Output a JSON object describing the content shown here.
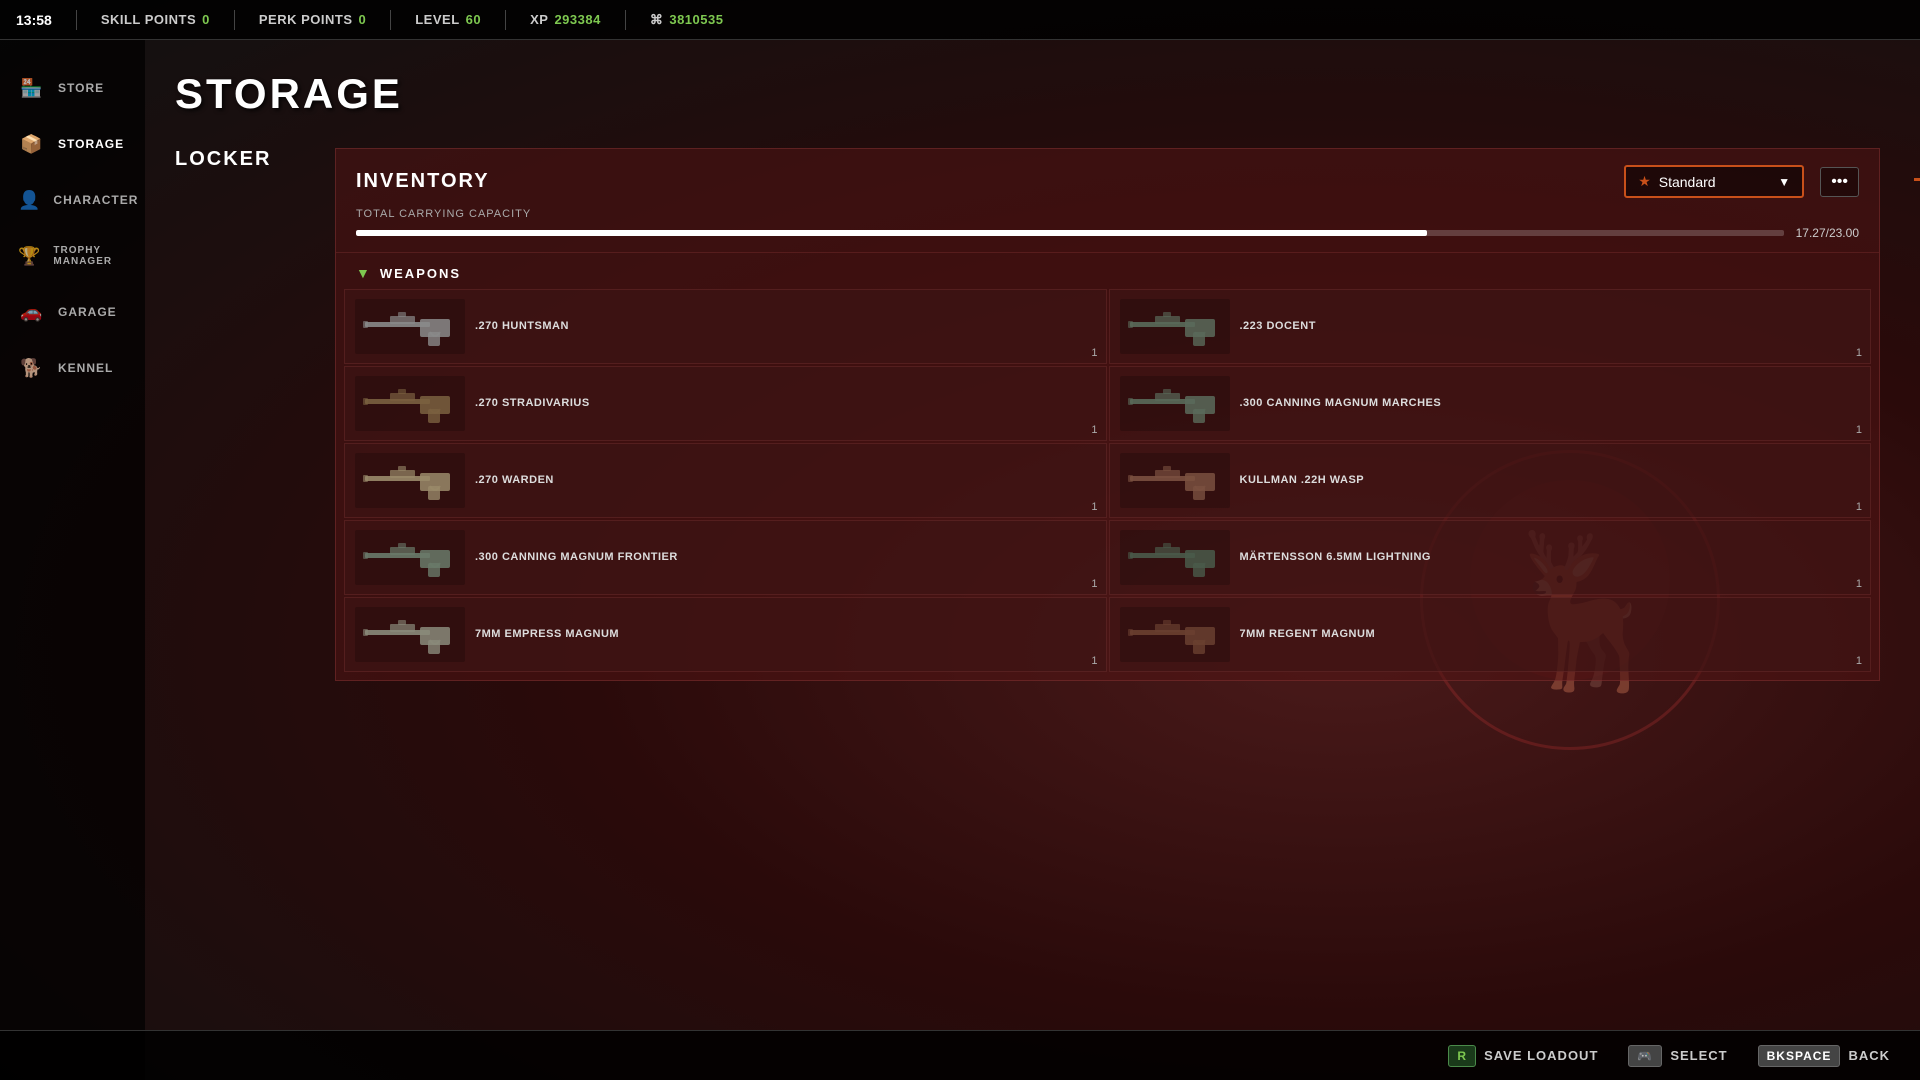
{
  "topbar": {
    "time": "13:58",
    "skill_points_label": "SKILL POINTS",
    "skill_points_value": "0",
    "perk_points_label": "PERK POINTS",
    "perk_points_value": "0",
    "level_label": "LEVEL",
    "level_value": "60",
    "xp_label": "XP",
    "xp_value": "293384",
    "currency_value": "3810535"
  },
  "sidebar": {
    "items": [
      {
        "id": "store",
        "label": "STORE",
        "icon": "🏪"
      },
      {
        "id": "storage",
        "label": "STORAGE",
        "icon": "📦",
        "active": true
      },
      {
        "id": "character",
        "label": "CHARACTER",
        "icon": "👤"
      },
      {
        "id": "trophy-manager",
        "label": "TROPHY MANAGER",
        "icon": "🏆"
      },
      {
        "id": "garage",
        "label": "GARAGE",
        "icon": "🚗"
      },
      {
        "id": "kennel",
        "label": "KENNEL",
        "icon": "🐕"
      }
    ]
  },
  "page": {
    "title": "STORAGE"
  },
  "locker": {
    "label": "LOCKER"
  },
  "inventory": {
    "label": "INVENTORY",
    "loadout_star": "★",
    "loadout_name": "Standard",
    "capacity_label": "TOTAL CARRYING CAPACITY",
    "capacity_current": "17.27",
    "capacity_max": "23.00",
    "capacity_display": "17.27/23.00",
    "capacity_percent": 75,
    "weapons_label": "WEAPONS"
  },
  "weapons": [
    {
      "id": "w1",
      "name": ".270 HUNTSMAN",
      "count": "1",
      "color": "#8a8a8a"
    },
    {
      "id": "w2",
      "name": ".223 DOCENT",
      "count": "1",
      "color": "#5a6a5a"
    },
    {
      "id": "w3",
      "name": ".270 STRADIVARIUS",
      "count": "1",
      "color": "#7a6040"
    },
    {
      "id": "w4",
      "name": ".300 CANNING MAGNUM MARCHES",
      "count": "1",
      "color": "#5a6a5a"
    },
    {
      "id": "w5",
      "name": ".270 WARDEN",
      "count": "1",
      "color": "#9a8a6a"
    },
    {
      "id": "w6",
      "name": "KULLMAN .22H WASP",
      "count": "1",
      "color": "#7a5040"
    },
    {
      "id": "w7",
      "name": ".300 CANNING MAGNUM FRONTIER",
      "count": "1",
      "color": "#6a7a6a"
    },
    {
      "id": "w8",
      "name": "MÄRTENSSON 6.5MM LIGHTNING",
      "count": "1",
      "color": "#4a5a4a"
    },
    {
      "id": "w9",
      "name": "7MM EMPRESS MAGNUM",
      "count": "1",
      "color": "#8a8a7a"
    },
    {
      "id": "w10",
      "name": "7MM REGENT MAGNUM",
      "count": "1",
      "color": "#6a4030"
    }
  ],
  "bottombar": {
    "save_loadout_key": "R",
    "save_loadout_label": "SAVE LOADOUT",
    "select_key": "🎮",
    "select_label": "SELECT",
    "back_key": "BKSPACE",
    "back_label": "BACK"
  }
}
